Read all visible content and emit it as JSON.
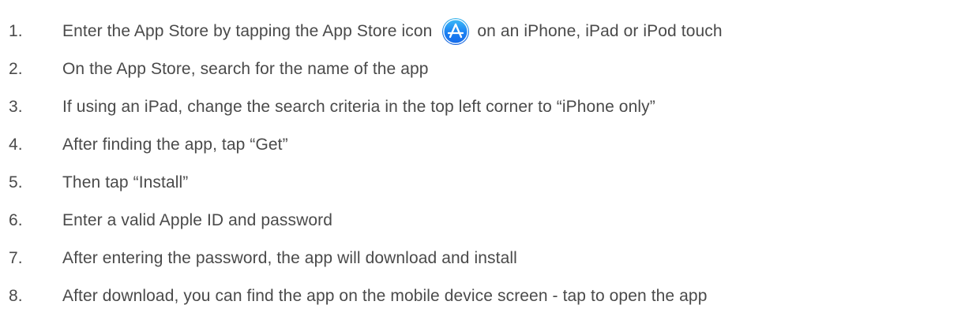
{
  "steps": [
    {
      "number": "1.",
      "text_before_icon": "Enter the App Store by tapping the App Store icon",
      "icon": "app-store-icon",
      "text_after_icon": "on an iPhone, iPad or iPod touch"
    },
    {
      "number": "2.",
      "text": "On the App Store, search for the name of the app"
    },
    {
      "number": "3.",
      "text": "If using an iPad, change the search criteria in the top left corner to “iPhone only”"
    },
    {
      "number": "4.",
      "text": "After finding the app, tap “Get”"
    },
    {
      "number": "5.",
      "text": "Then tap “Install”"
    },
    {
      "number": "6.",
      "text": "Enter a valid Apple ID and password"
    },
    {
      "number": "7.",
      "text": "After entering the password, the app will download and install"
    },
    {
      "number": "8.",
      "text": "After download, you can find the app on the mobile device screen - tap to open the app"
    }
  ],
  "colors": {
    "text": "#4a4a4a",
    "icon_gradient_top": "#3fc0f8",
    "icon_gradient_bottom": "#1668e8"
  }
}
